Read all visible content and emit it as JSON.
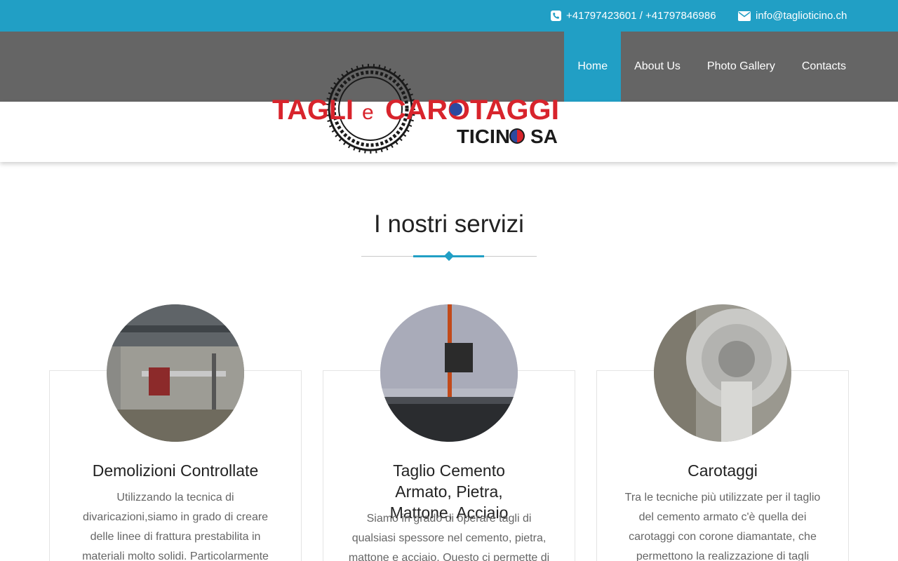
{
  "topbar": {
    "phone": "+41797423601 / +41797846986",
    "email": "info@taglioticino.ch",
    "phone_icon": "phone-square-icon",
    "email_icon": "envelope-icon"
  },
  "nav": {
    "items": [
      {
        "label": "Home"
      },
      {
        "label": "About Us"
      },
      {
        "label": "Photo Gallery"
      },
      {
        "label": "Contacts"
      }
    ]
  },
  "logo": {
    "line1a": "TAGLI",
    "line1b": "e",
    "line1c": "CAROTAGGI",
    "line2a": "TICIN",
    "line2b": "SA",
    "colors": {
      "red": "#d8242c",
      "dark": "#1b1b1b",
      "blue": "#2b4aa0"
    }
  },
  "section": {
    "title": "I nostri servizi"
  },
  "services": [
    {
      "title": "Demolizioni Controllate",
      "text": "Utilizzando la tecnica di divaricazioni,siamo in grado di creare delle linee di frattura prestabilita in materiali molto solidi. Particolarmente"
    },
    {
      "title": "Taglio Cemento Armato, Pietra, Mattone, Acciaio",
      "text": "Siamo in grado di operare tagli di qualsiasi spessore nel cemento, pietra, mattone e acciaio. Questo ci permette di"
    },
    {
      "title": "Carotaggi",
      "text": "Tra le tecniche più utilizzate per il taglio del cemento armato c'è quella dei carotaggi con corone diamantate, che permettono la realizzazione di tagli"
    }
  ],
  "colors": {
    "accent": "#219fc5",
    "nav_bg": "#656565"
  }
}
